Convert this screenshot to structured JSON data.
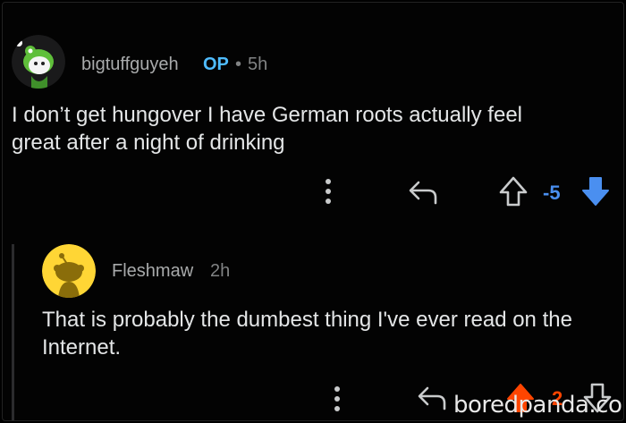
{
  "comments": [
    {
      "username": "bigtuffguyeh",
      "op_badge": "OP",
      "separator": "•",
      "time": "5h",
      "text_line1": "I don’t get hungover I have German roots actually feel",
      "text_line2": "great after a night of drinking",
      "score": "-5",
      "vote_state": "downvoted",
      "icons": [
        "snoo-avatar-icon",
        "more-options-icon",
        "reply-icon",
        "upvote-icon",
        "downvote-icon"
      ]
    },
    {
      "username": "Fleshmaw",
      "time": "2h",
      "text_line1": "That is probably the dumbest thing I've ever read on the",
      "text_line2": "Internet.",
      "score": "2",
      "vote_state": "upvoted",
      "icons": [
        "default-avatar-icon",
        "more-options-icon",
        "reply-icon",
        "upvote-icon",
        "downvote-icon"
      ]
    }
  ],
  "watermark": "boredpanda.com",
  "colors": {
    "op_blue": "#4fbcff",
    "downvote_blue": "#4a8ff0",
    "upvote_orange": "#ff4500",
    "avatar_yellow": "#ffd635"
  }
}
